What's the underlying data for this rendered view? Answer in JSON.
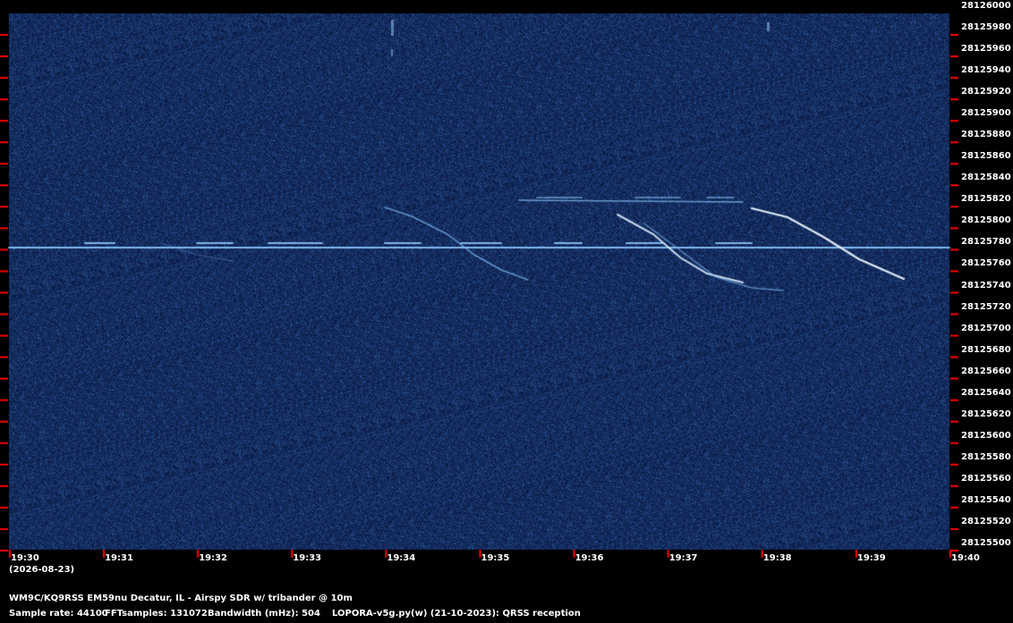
{
  "colors": {
    "background": "#000000",
    "waterfall": "#0b1a4a",
    "tick": "#ff0000",
    "signal": "#aad4ff"
  },
  "frequency_axis": {
    "labels": [
      "28126000",
      "28125980",
      "28125960",
      "28125940",
      "28125920",
      "28125900",
      "28125880",
      "28125860",
      "28125840",
      "28125820",
      "28125800",
      "28125780",
      "28125760",
      "28125740",
      "28125720",
      "28125700",
      "28125680",
      "28125660",
      "28125640",
      "28125620",
      "28125600",
      "28125580",
      "28125560",
      "28125540",
      "28125520",
      "28125500"
    ]
  },
  "time_axis": {
    "labels": [
      "19:30",
      "19:31",
      "19:32",
      "19:33",
      "19:34",
      "19:35",
      "19:36",
      "19:37",
      "19:38",
      "19:39",
      "19:40"
    ],
    "date": "(2026-08-23)"
  },
  "footer": {
    "station": "WM9C/KQ9RSS EM59nu Decatur, IL - Airspy SDR w/ tribander @ 10m",
    "sample_rate": "Sample rate: 44100",
    "fft_samples": "FFTsamples: 131072",
    "bandwidth": "Bandwidth (mHz): 504",
    "software": "LOPORA-v5g.py(w) (21-10-2023): QRSS reception"
  }
}
